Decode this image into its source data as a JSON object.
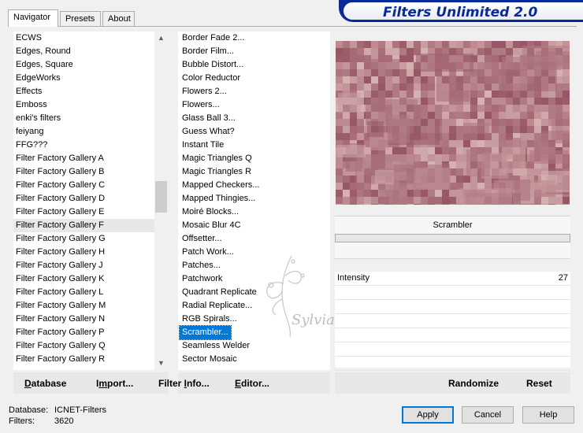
{
  "tabs": [
    {
      "label": "Navigator",
      "active": true
    },
    {
      "label": "Presets",
      "active": false
    },
    {
      "label": "About",
      "active": false
    }
  ],
  "banner": {
    "title": "Filters Unlimited 2.0"
  },
  "categories": [
    "ECWS",
    "Edges, Round",
    "Edges, Square",
    "EdgeWorks",
    "Effects",
    "Emboss",
    "enki's filters",
    "feiyang",
    "FFG???",
    "Filter Factory Gallery A",
    "Filter Factory Gallery B",
    "Filter Factory Gallery C",
    "Filter Factory Gallery D",
    "Filter Factory Gallery E",
    "Filter Factory Gallery F",
    "Filter Factory Gallery G",
    "Filter Factory Gallery H",
    "Filter Factory Gallery J",
    "Filter Factory Gallery K",
    "Filter Factory Gallery L",
    "Filter Factory Gallery M",
    "Filter Factory Gallery N",
    "Filter Factory Gallery P",
    "Filter Factory Gallery Q",
    "Filter Factory Gallery R"
  ],
  "selected_category": "Filter Factory Gallery F",
  "filters": [
    "Border Fade 2...",
    "Border Film...",
    "Bubble Distort...",
    "Color Reductor",
    "Flowers 2...",
    "Flowers...",
    "Glass Ball 3...",
    "Guess What?",
    "Instant Tile",
    "Magic Triangles Q",
    "Magic Triangles R",
    "Mapped Checkers...",
    "Mapped Thingies...",
    "Moiré Blocks...",
    "Mosaic Blur 4C",
    "Offsetter...",
    "Patch Work...",
    "Patches...",
    "Patchwork",
    "Quadrant Replicate",
    "Radial Replicate...",
    "RGB Spirals...",
    "Scrambler...",
    "Seamless Welder",
    "Sector Mosaic"
  ],
  "selected_filter": "Scrambler...",
  "filter_name": "Scrambler",
  "params": [
    {
      "label": "Intensity",
      "value": "27"
    }
  ],
  "left_buttons": {
    "database": {
      "u": "D",
      "rest": "atabase"
    },
    "import": {
      "pre": "I",
      "u": "m",
      "rest": "port..."
    },
    "filter_info": {
      "pre": "Filter ",
      "u": "I",
      "rest": "nfo..."
    },
    "editor": {
      "u": "E",
      "rest": "ditor..."
    }
  },
  "right_buttons": {
    "randomize": "Randomize",
    "reset": "Reset"
  },
  "status": {
    "database_label": "Database:",
    "database_value": "ICNET-Filters",
    "filters_label": "Filters:",
    "filters_value": "3620"
  },
  "dialog_buttons": {
    "apply": "Apply",
    "cancel": "Cancel",
    "help": "Help"
  },
  "watermark_text": "Sylviane",
  "colors": {
    "selection": "#0078d7",
    "banner": "#0a2a9a",
    "preview_base": "#b6858d"
  }
}
